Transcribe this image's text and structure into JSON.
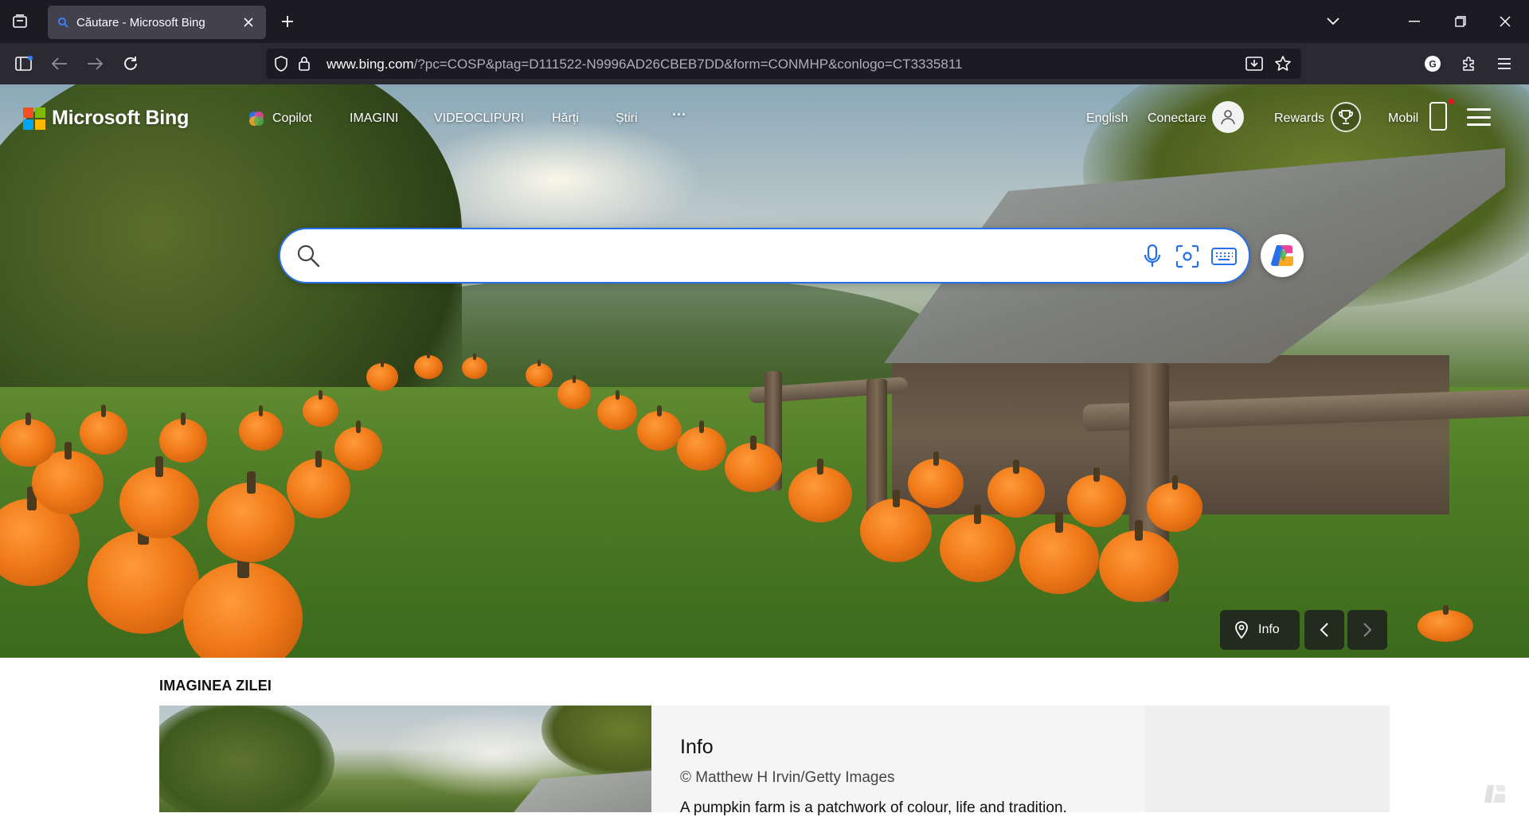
{
  "browser": {
    "tab_title": "Căutare - Microsoft Bing",
    "url_host": "www.bing.com",
    "url_rest": "/?pc=COSP&ptag=D111522-N9996AD26CBEB7DD&form=CONMHP&conlogo=CT3335811"
  },
  "bing": {
    "logo_text": "Microsoft Bing",
    "scopes": [
      "Copilot",
      "IMAGINI",
      "VIDEOCLIPURI",
      "Hărți",
      "Știri"
    ],
    "more_label": "···",
    "language": "English",
    "sign_in": "Conectare",
    "rewards": "Rewards",
    "mobile": "Mobil",
    "brand_colors": {
      "red": "#f25022",
      "green": "#7fba00",
      "blue": "#00a4ef",
      "yellow": "#ffb900"
    }
  },
  "search": {
    "placeholder": "",
    "value": ""
  },
  "hero": {
    "info_label": "Info"
  },
  "image_of_day": {
    "section_title": "IMAGINEA ZILEI",
    "info_title": "Info",
    "credit": "© Matthew H Irvin/Getty Images",
    "description": "A pumpkin farm is a patchwork of colour, life and tradition."
  }
}
